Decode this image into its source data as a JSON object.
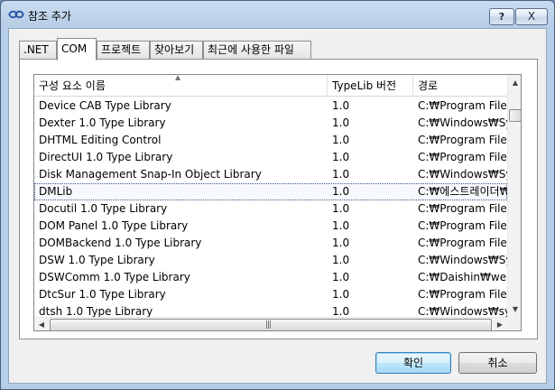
{
  "window": {
    "title": "참조 추가"
  },
  "titlebar": {
    "help_label": "?",
    "close_label": "X"
  },
  "tabs": [
    {
      "label": ".NET"
    },
    {
      "label": "COM"
    },
    {
      "label": "프로젝트"
    },
    {
      "label": "찾아보기"
    },
    {
      "label": "최근에 사용한 파일"
    }
  ],
  "list": {
    "columns": [
      {
        "label": "구성 요소 이름"
      },
      {
        "label": "TypeLib 버전"
      },
      {
        "label": "경로"
      }
    ],
    "rows": [
      {
        "name": "Device CAB Type Library",
        "version": "1.0",
        "path": "C:₩Program Files ("
      },
      {
        "name": "Dexter 1.0 Type Library",
        "version": "1.0",
        "path": "C:₩Windows₩Syst"
      },
      {
        "name": "DHTML Editing Control",
        "version": "1.0",
        "path": "C:₩Program Files ("
      },
      {
        "name": "DirectUI 1.0 Type Library",
        "version": "1.0",
        "path": "C:₩Program Files ("
      },
      {
        "name": "Disk Management Snap-In Object Library",
        "version": "1.0",
        "path": "C:₩Windows₩Syst"
      },
      {
        "name": "DMLib",
        "version": "1.0",
        "path": "C:₩에스트레이더₩"
      },
      {
        "name": "Docutil 1.0 Type Library",
        "version": "1.0",
        "path": "C:₩Program Files ("
      },
      {
        "name": "DOM Panel 1.0 Type Library",
        "version": "1.0",
        "path": "C:₩Program Files ("
      },
      {
        "name": "DOMBackend 1.0 Type Library",
        "version": "1.0",
        "path": "C:₩Program Files ("
      },
      {
        "name": "DSW 1.0 Type Library",
        "version": "1.0",
        "path": "C:₩Windows₩SysV"
      },
      {
        "name": "DSWComm 1.0 Type Library",
        "version": "1.0",
        "path": "C:₩Daishin₩web₩"
      },
      {
        "name": "DtcSur 1.0 Type Library",
        "version": "1.0",
        "path": "C:₩Program Files ("
      },
      {
        "name": "dtsh 1.0 Type Library",
        "version": "1.0",
        "path": "C:₩Windows₩syst"
      }
    ],
    "selected_index": 5,
    "sort_indicator": "▲"
  },
  "scroll": {
    "up": "▲",
    "down": "▼",
    "left": "◀",
    "right": "▶",
    "grip": "|||"
  },
  "buttons": {
    "ok_label": "확인",
    "cancel_label": "취소"
  },
  "colors": {
    "accent": "#3c7fb1",
    "title_bg": "#b6cde6"
  }
}
